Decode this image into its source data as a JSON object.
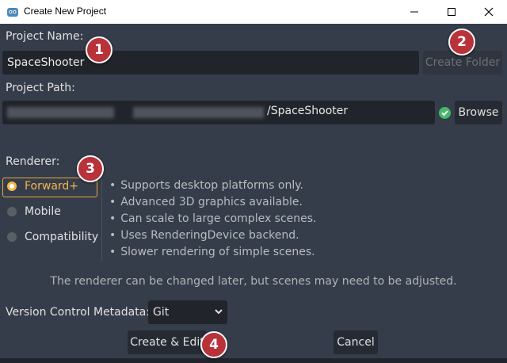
{
  "window": {
    "title": "Create New Project"
  },
  "project_name": {
    "label": "Project Name:",
    "value": "SpaceShooter",
    "create_folder_label": "Create Folder"
  },
  "project_path": {
    "label": "Project Path:",
    "value_suffix": "/SpaceShooter",
    "browse_label": "Browse",
    "status_color": "#45b96a"
  },
  "renderer": {
    "label": "Renderer:",
    "options": [
      {
        "label": "Forward+",
        "selected": true
      },
      {
        "label": "Mobile",
        "selected": false
      },
      {
        "label": "Compatibility",
        "selected": false
      }
    ],
    "features": [
      "Supports desktop platforms only.",
      "Advanced 3D graphics available.",
      "Can scale to large complex scenes.",
      "Uses RenderingDevice backend.",
      "Slower rendering of simple scenes."
    ],
    "note": "The renderer can be changed later, but scenes may need to be adjusted."
  },
  "vcs": {
    "label": "Version Control Metadata:",
    "value": "Git"
  },
  "actions": {
    "create_label": "Create & Edit",
    "cancel_label": "Cancel"
  },
  "badges": [
    "1",
    "2",
    "3",
    "4"
  ],
  "colors": {
    "accent": "#f5b64b",
    "badge": "#b8323a",
    "background": "#363d4a"
  }
}
